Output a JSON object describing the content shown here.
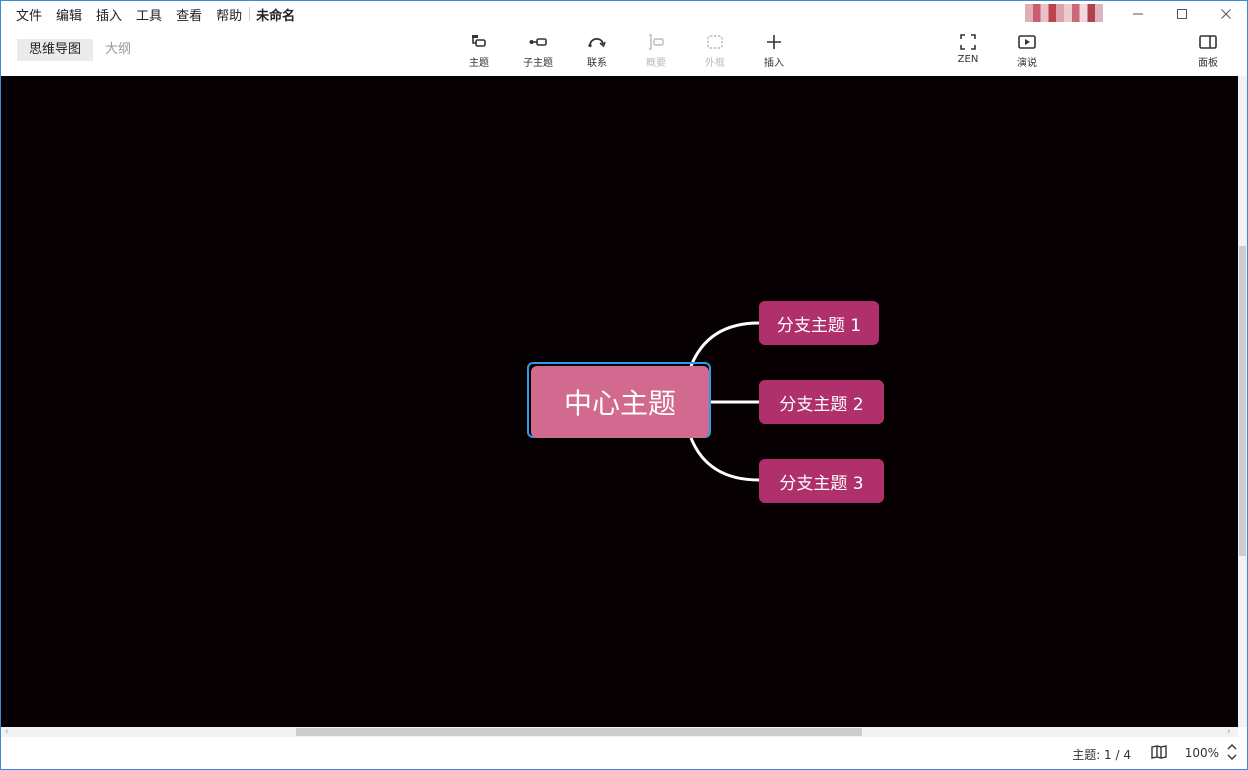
{
  "menu": [
    "文件",
    "编辑",
    "插入",
    "工具",
    "查看",
    "帮助"
  ],
  "document_title": "未命名",
  "window_controls": {
    "minimize": "—",
    "maximize": "☐",
    "close": "✕"
  },
  "view_tabs": {
    "mindmap": "思维导图",
    "outline": "大纲"
  },
  "toolbar": {
    "topic": "主题",
    "subtopic": "子主题",
    "relationship": "联系",
    "summary": "概要",
    "boundary": "外框",
    "insert": "插入",
    "zen": "ZEN",
    "presentation": "演说",
    "panel": "面板"
  },
  "mindmap": {
    "central": "中心主题",
    "branches": [
      "分支主题 1",
      "分支主题 2",
      "分支主题 3"
    ]
  },
  "status": {
    "topics": "主题: 1 / 4",
    "zoom": "100%"
  },
  "colors": {
    "canvas": "#060003",
    "central_topic": "#d2698e",
    "branch_topic": "#b0306c",
    "selection": "#2d9be8"
  }
}
